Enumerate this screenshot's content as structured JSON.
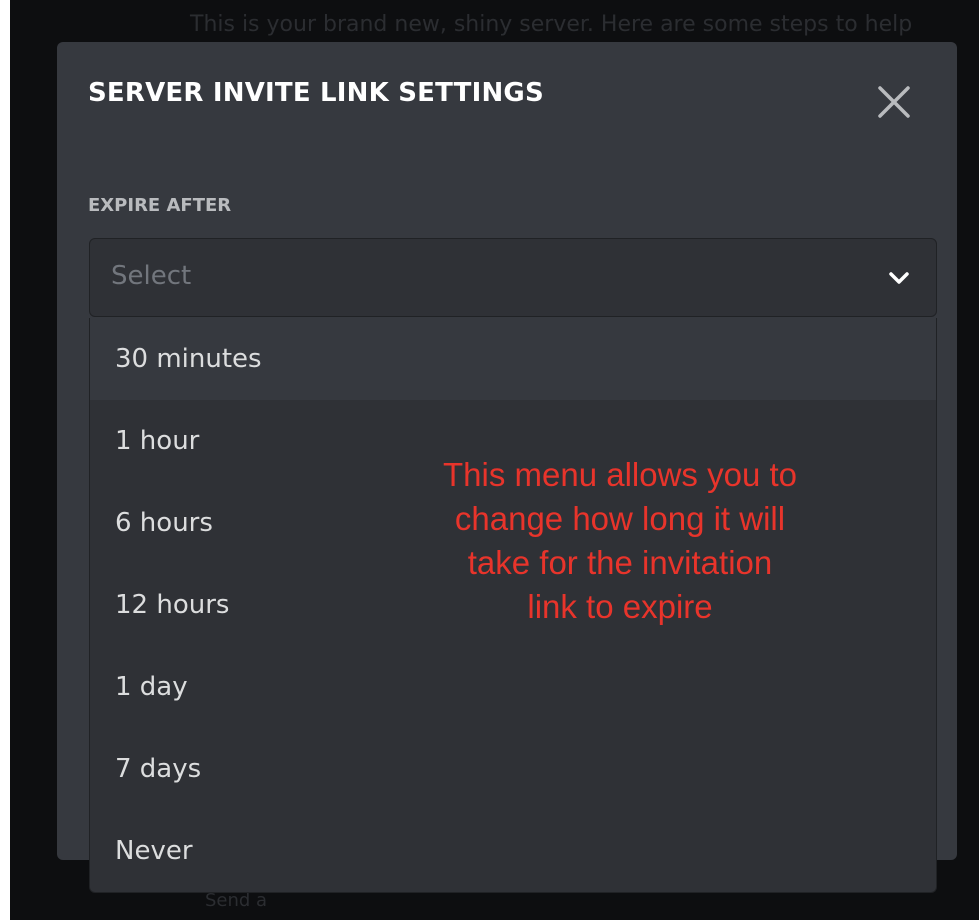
{
  "background": {
    "top_text": "This is your brand new, shiny server. Here are some steps to help",
    "bottom_text": "Send a"
  },
  "modal": {
    "title": "SERVER INVITE LINK SETTINGS",
    "close_icon": "close-icon"
  },
  "expire_field": {
    "label": "EXPIRE AFTER",
    "placeholder": "Select",
    "chevron_icon": "chevron-down-icon",
    "options": [
      "30 minutes",
      "1 hour",
      "6 hours",
      "12 hours",
      "1 day",
      "7 days",
      "Never"
    ]
  },
  "annotation": {
    "lines": [
      "This menu allows you to",
      "change how long it will",
      "take for the invitation",
      "link to expire"
    ],
    "color": "#e8342b"
  },
  "colors": {
    "modal_bg": "#36393f",
    "input_bg": "#2f3136",
    "backdrop": "#0d0e10"
  }
}
